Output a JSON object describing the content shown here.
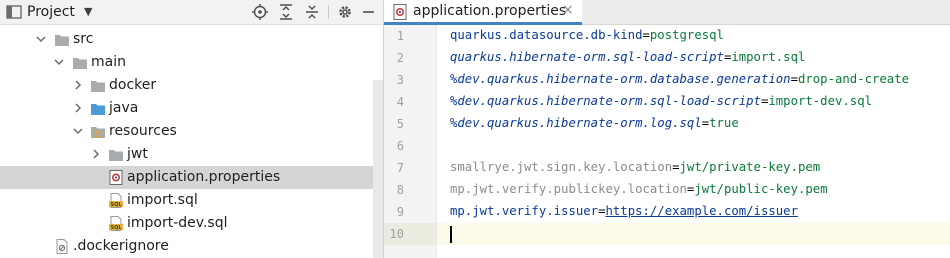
{
  "project_panel": {
    "title": "Project",
    "toolbar_icons": [
      "locate-icon",
      "expand-all-icon",
      "collapse-all-icon",
      "settings-icon",
      "hide-icon"
    ]
  },
  "tree": [
    {
      "label": "src",
      "depth": 0,
      "expanded": true,
      "icon": "folder-icon"
    },
    {
      "label": "main",
      "depth": 1,
      "expanded": true,
      "icon": "folder-icon"
    },
    {
      "label": "docker",
      "depth": 2,
      "expanded": false,
      "icon": "folder-icon"
    },
    {
      "label": "java",
      "depth": 2,
      "expanded": false,
      "icon": "source-folder-icon"
    },
    {
      "label": "resources",
      "depth": 2,
      "expanded": true,
      "icon": "resources-folder-icon"
    },
    {
      "label": "jwt",
      "depth": 3,
      "expanded": false,
      "icon": "folder-icon"
    },
    {
      "label": "application.properties",
      "depth": 3,
      "icon": "properties-file-icon",
      "selected": true
    },
    {
      "label": "import.sql",
      "depth": 3,
      "icon": "sql-file-icon"
    },
    {
      "label": "import-dev.sql",
      "depth": 3,
      "icon": "sql-file-icon"
    },
    {
      "label": ".dockerignore",
      "depth": 0,
      "icon": "ignore-file-icon"
    }
  ],
  "editor": {
    "tab": {
      "label": "application.properties",
      "close": "×"
    },
    "current_line": 10,
    "lines": [
      {
        "n": "1",
        "key": "quarkus.datasource.db-kind",
        "value": "postgresql"
      },
      {
        "n": "2",
        "key": "quarkus.hibernate-orm.sql-load-script",
        "value": "import.sql"
      },
      {
        "n": "3",
        "key": "%dev.quarkus.hibernate-orm.database.generation",
        "value": "drop-and-create"
      },
      {
        "n": "4",
        "key": "%dev.quarkus.hibernate-orm.sql-load-script",
        "value": "import-dev.sql"
      },
      {
        "n": "5",
        "key": "%dev.quarkus.hibernate-orm.log.sql",
        "value": "true"
      },
      {
        "n": "6"
      },
      {
        "n": "7",
        "key": "smallrye.jwt.sign.key.location",
        "value": "jwt/private-key.pem"
      },
      {
        "n": "8",
        "key": "mp.jwt.verify.publickey.location",
        "value": "jwt/public-key.pem"
      },
      {
        "n": "9",
        "key": "mp.jwt.verify.issuer",
        "value": "https://example.com/issuer"
      },
      {
        "n": "10"
      }
    ]
  },
  "colors": {
    "accent": "#4083c9",
    "selection": "#d5d5d5",
    "key": "#0b3a96",
    "value": "#0a7a3a"
  }
}
